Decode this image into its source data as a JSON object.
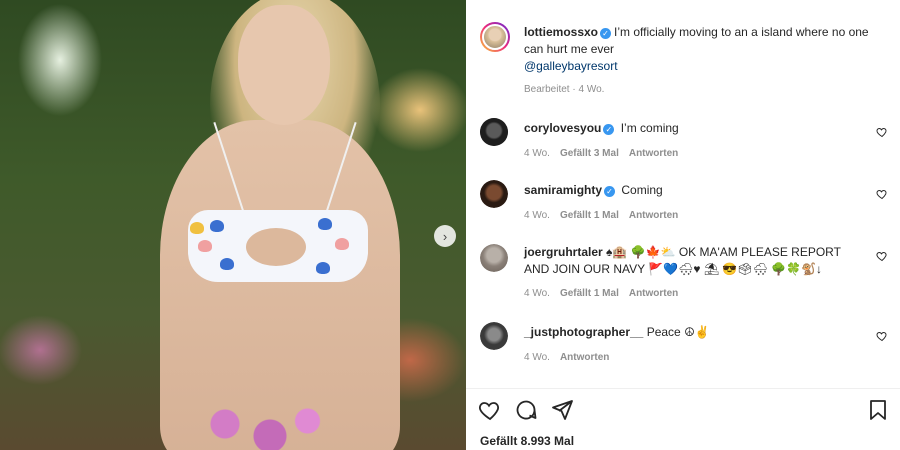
{
  "post": {
    "author": "lottiemossxo",
    "caption": "I’m officially moving to an a island where no one can hurt me ever",
    "mention": "@galleybayresort",
    "meta": "Bearbeitet · 4 Wo."
  },
  "comments": [
    {
      "user": "corylovesyou",
      "verified": true,
      "text": "I’m coming",
      "age": "4 Wo.",
      "likes": "Gefällt 3 Mal",
      "reply": "Antworten"
    },
    {
      "user": "samiramighty",
      "verified": true,
      "text": "Coming",
      "age": "4 Wo.",
      "likes": "Gefällt 1 Mal",
      "reply": "Antworten"
    },
    {
      "user": "joergruhrtaler",
      "verified": false,
      "text": "♠🏨 🌳🍁⛅ OK MA'AM PLEASE REPORT AND JOIN OUR NAVY 🚩💙🌨♥ ⛱ 😎🗳🌨 🌳🍀🐒↓",
      "age": "4 Wo.",
      "likes": "Gefällt 1 Mal",
      "reply": "Antworten"
    },
    {
      "user": "_justphotographer__",
      "verified": false,
      "text": "Peace ☮✌",
      "age": "4 Wo.",
      "likes": "",
      "reply": "Antworten"
    }
  ],
  "footer": {
    "likes": "Gefällt 8.993 Mal"
  },
  "icons": {
    "like": "heart-icon",
    "comment": "comment-icon",
    "share": "send-icon",
    "save": "bookmark-icon",
    "next": "chevron-right-icon",
    "verified": "verified-badge-icon"
  },
  "colors": {
    "verified": "#3897f0",
    "text": "#262626",
    "muted": "#8e8e8e",
    "mention": "#00376b"
  }
}
